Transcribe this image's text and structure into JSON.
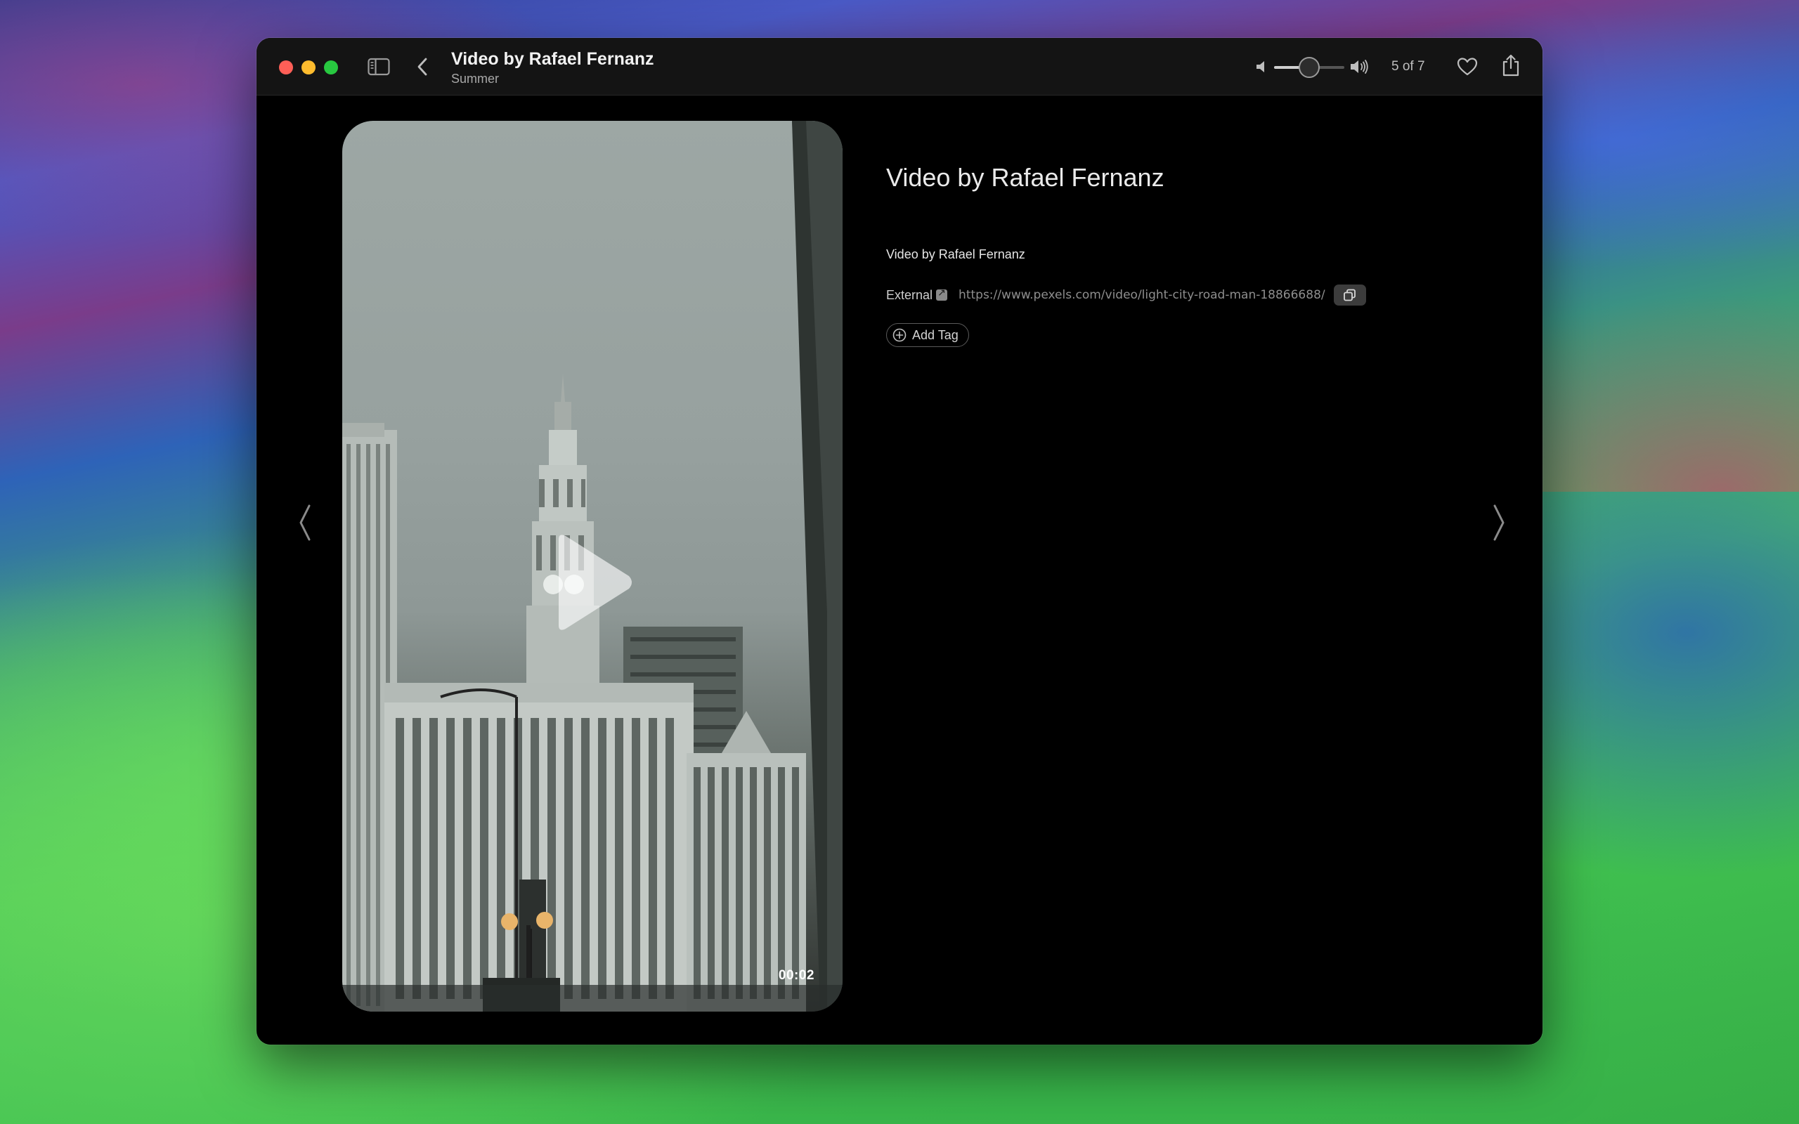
{
  "window": {
    "title": "Video by Rafael Fernanz",
    "subtitle": "Summer",
    "counter": "5 of 7",
    "volume_level": 0.5
  },
  "video": {
    "duration": "00:02"
  },
  "details": {
    "title": "Video by Rafael Fernanz",
    "description": "Video by Rafael Fernanz",
    "link_label": "External",
    "link_url": "https://www.pexels.com/video/light-city-road-man-18866688/",
    "add_tag_label": "Add Tag"
  },
  "icons": {
    "sidebar": "sidebar-icon",
    "back": "chevron-left-icon",
    "volume_low": "speaker-low-icon",
    "volume_high": "speaker-high-icon",
    "favorite": "heart-icon",
    "share": "share-icon",
    "prev": "chevron-left-icon",
    "next": "chevron-right-icon",
    "play": "play-icon",
    "external": "external-link-icon",
    "copy": "copy-icon",
    "add": "plus-circle-icon"
  },
  "colors": {
    "close": "#fe5f57",
    "minimize": "#febc2e",
    "zoom": "#28c840",
    "window_bg": "#000000",
    "titlebar_bg": "#141414"
  }
}
